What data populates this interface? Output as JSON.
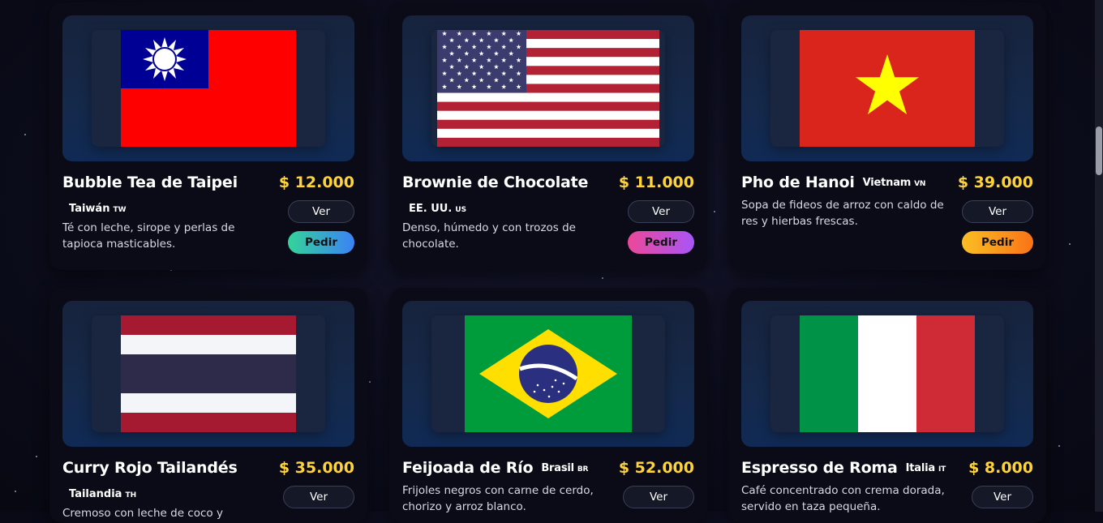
{
  "cards": [
    {
      "title": "Bubble Tea de Taipei",
      "country": "Taiwán",
      "code": "TW",
      "price": "$ 12.000",
      "desc": "Té con leche, sirope y perlas de tapioca masticables.",
      "ver": "Ver",
      "pedir": "Pedir",
      "flag": "taiwan-flag"
    },
    {
      "title": "Brownie de Chocolate",
      "country": "EE. UU.",
      "code": "US",
      "price": "$ 11.000",
      "desc": "Denso, húmedo y con trozos de chocolate.",
      "ver": "Ver",
      "pedir": "Pedir",
      "flag": "usa-flag"
    },
    {
      "title": "Pho de Hanoi",
      "country": "Vietnam",
      "code": "VN",
      "price": "$ 39.000",
      "desc": "Sopa de fideos de arroz con caldo de res y hierbas frescas.",
      "ver": "Ver",
      "pedir": "Pedir",
      "flag": "vietnam-flag"
    },
    {
      "title": "Curry Rojo Tailandés",
      "country": "Tailandia",
      "code": "TH",
      "price": "$ 35.000",
      "desc": "Cremoso con leche de coco y",
      "ver": "Ver",
      "flag": "thailand-flag"
    },
    {
      "title": "Feijoada de Río",
      "country": "Brasil",
      "code": "BR",
      "price": "$ 52.000",
      "desc": "Frijoles negros con carne de cerdo, chorizo y arroz blanco.",
      "ver": "Ver",
      "flag": "brazil-flag"
    },
    {
      "title": "Espresso de Roma",
      "country": "Italia",
      "code": "IT",
      "price": "$ 8.000",
      "desc": "Café concentrado con crema dorada, servido en taza pequeña.",
      "ver": "Ver",
      "flag": "italy-flag"
    }
  ],
  "colors": {
    "price": "#ffd43b",
    "pedir_taiwan": [
      "#34d399",
      "#3b82f6"
    ],
    "pedir_usa": [
      "#ec4899",
      "#a855f7"
    ],
    "pedir_vietnam": [
      "#fbbf24",
      "#f97316"
    ]
  }
}
